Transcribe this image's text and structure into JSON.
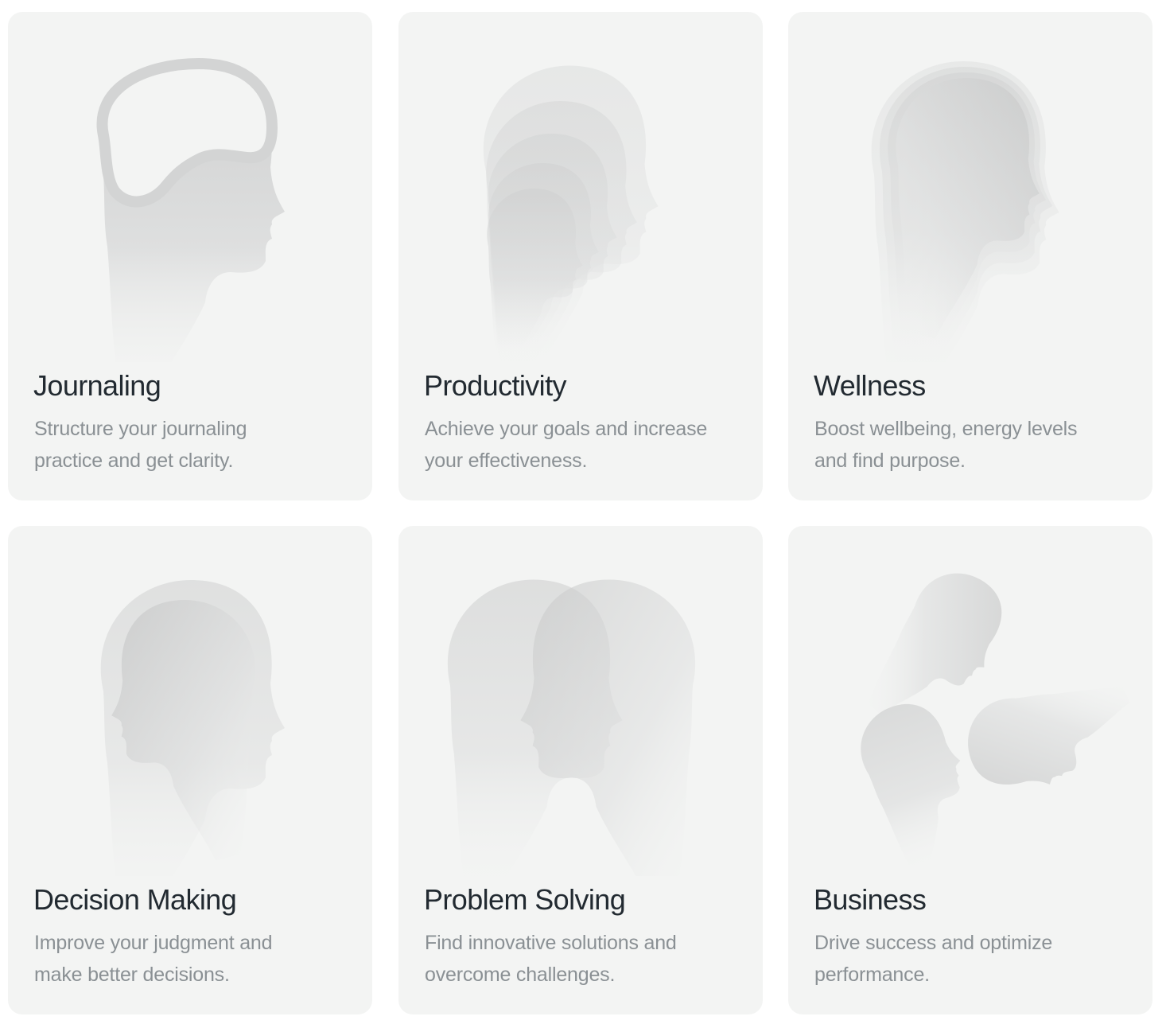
{
  "cards": [
    {
      "title": "Journaling",
      "description": "Structure your journaling practice and get clarity.",
      "icon": "brain-head-icon"
    },
    {
      "title": "Productivity",
      "description": "Achieve your goals and increase your effectiveness.",
      "icon": "stacked-heads-icon"
    },
    {
      "title": "Wellness",
      "description": "Boost wellbeing, energy levels and find purpose.",
      "icon": "layered-head-icon"
    },
    {
      "title": "Decision Making",
      "description": "Improve your judgment and make better decisions.",
      "icon": "double-head-icon"
    },
    {
      "title": "Problem Solving",
      "description": "Find innovative solutions and overcome challenges.",
      "icon": "facing-heads-icon"
    },
    {
      "title": "Business",
      "description": "Drive success and optimize performance.",
      "icon": "three-heads-icon"
    }
  ],
  "colors": {
    "card_background": "#f3f4f3",
    "title": "#222a31",
    "description": "#8a9094",
    "silhouette": "#c8c9c9"
  }
}
